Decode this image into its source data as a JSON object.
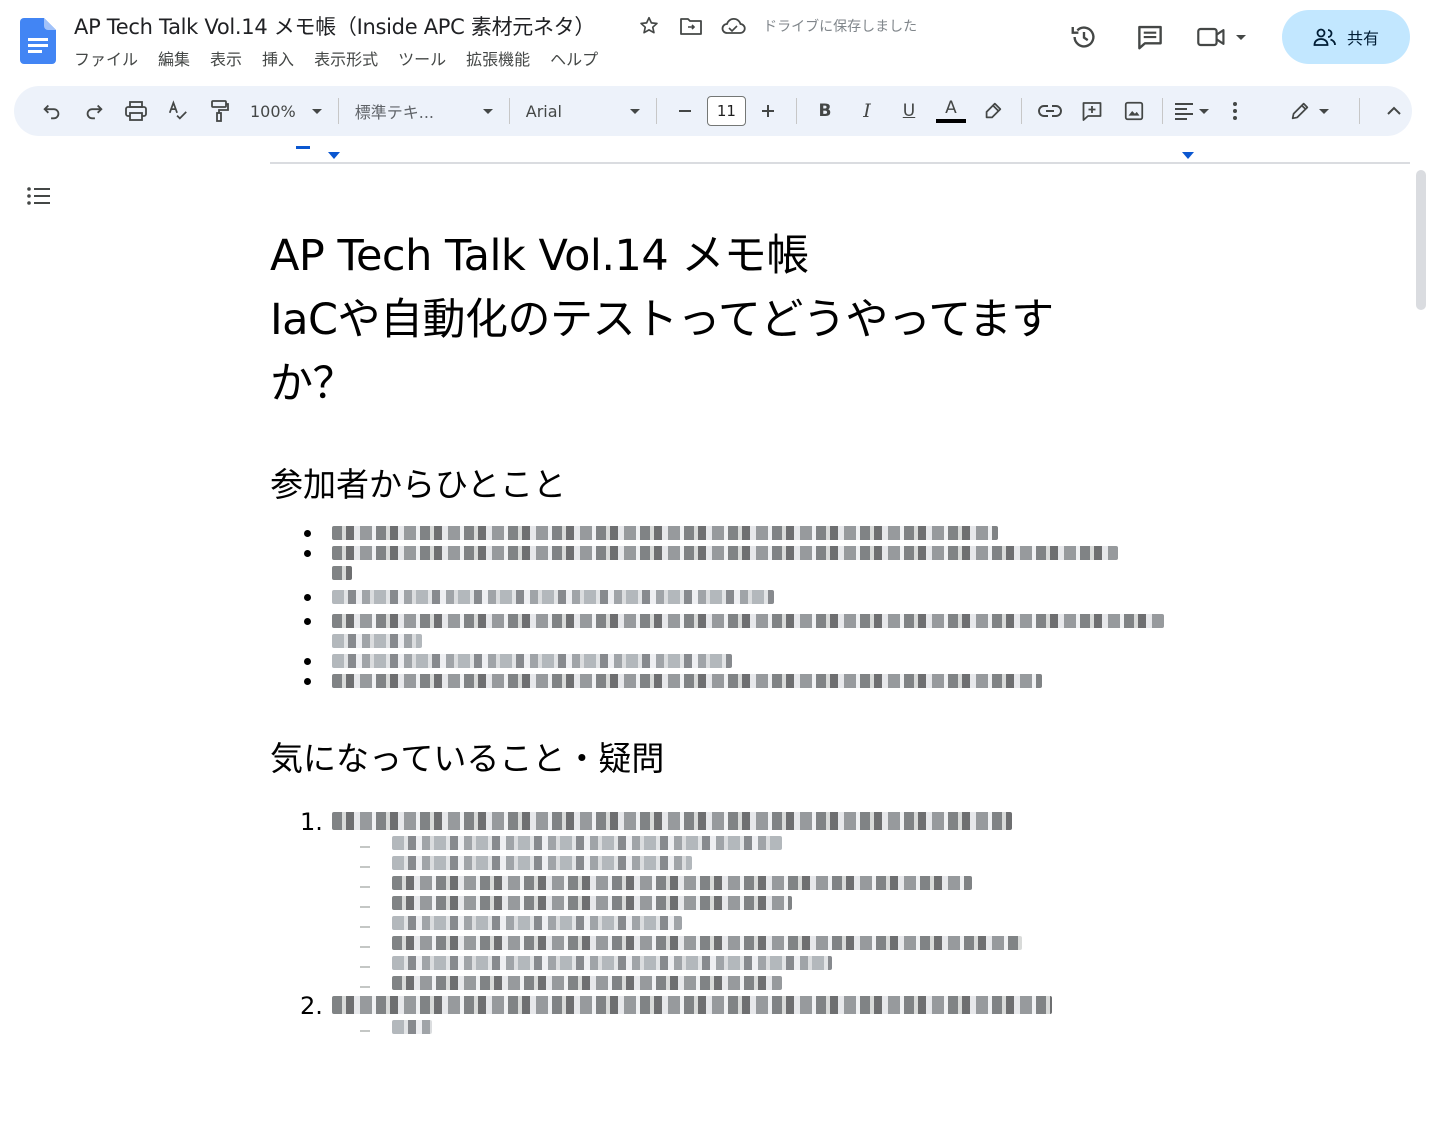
{
  "header": {
    "doc_title": "AP Tech Talk Vol.14 メモ帳（Inside APC 素材元ネタ）",
    "save_status": "ドライブに保存しました",
    "share_label": "共有"
  },
  "menu": [
    "ファイル",
    "編集",
    "表示",
    "挿入",
    "表示形式",
    "ツール",
    "拡張機能",
    "ヘルプ"
  ],
  "toolbar": {
    "zoom": "100%",
    "style": "標準テキ...",
    "font": "Arial",
    "font_size": "11",
    "bold": "B",
    "italic": "I",
    "underline": "U",
    "text_color": "A"
  },
  "document": {
    "title_line1": "AP Tech Talk Vol.14 メモ帳",
    "title_line2": "IaCや自動化のテストってどうやってます",
    "title_line3": "か？",
    "heading1": "参加者からひとこと",
    "heading2": "気になっていること・疑問",
    "num1": "1.",
    "num2": "2."
  },
  "colors": {
    "accent": "#0b57d0",
    "share_bg": "#c2e7ff",
    "toolbar_bg": "#edf2fa"
  }
}
